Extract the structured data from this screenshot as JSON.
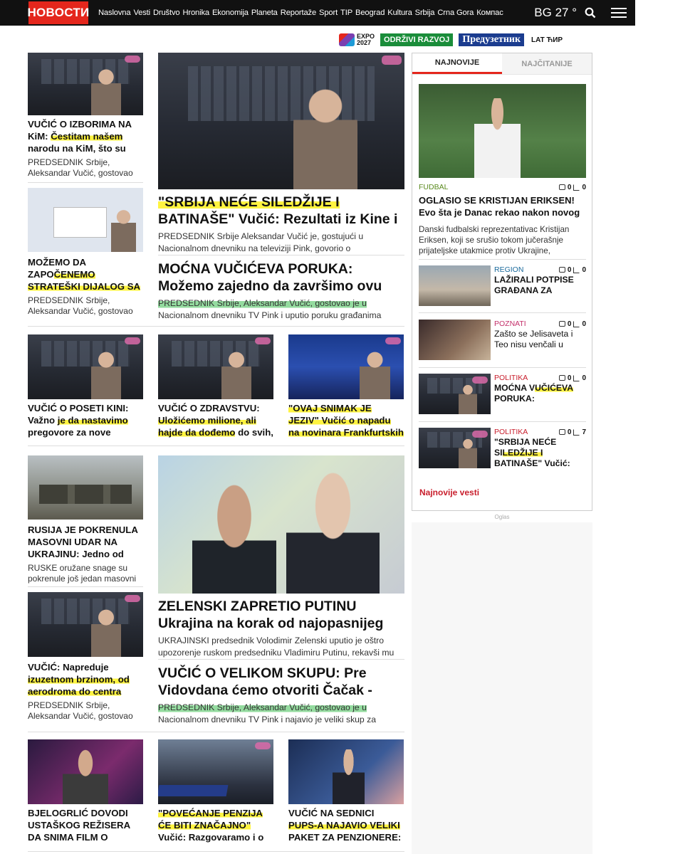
{
  "header": {
    "logo": "НОВОСТИ",
    "nav": [
      "Naslovna",
      "Vesti",
      "Društvo",
      "Hronika",
      "Ekonomija",
      "Planeta",
      "Reportaže",
      "Sport",
      "TIP",
      "Beograd",
      "Kultura",
      "Srbija",
      "Crna Gora",
      "Компас"
    ],
    "weather": "BG 27 °",
    "search_icon": "search-icon",
    "menu_icon": "hamburger-icon"
  },
  "subbar": {
    "expo": "EXPO",
    "expo_year": "2027",
    "odrzivi": "ODRŽIVI RAZVOJ",
    "preduzetnik": "Предузетник",
    "lang": "LAT ЋИР"
  },
  "articles": [
    {
      "headline_a": "VUČIĆ O IZBORIMA NA KiM: ",
      "headline_hl": "Čestitam našem",
      "headline_b": " narodu na KiM, što su",
      "lead": "PREDSEDNIK Srbije, Aleksandar Vučić, gostovao"
    },
    {
      "headline_a": "MOŽEMO DA ZAPO",
      "headline_hl": "ČENEMO STRATEŠKI DIJALOG SA SAD Vučić:",
      "headline_b": "",
      "lead": "PREDSEDNIK Srbije, Aleksandar Vučić, gostovao"
    },
    {
      "headline_a": "",
      "headline_hl": "\"SRBIJA NEĆE SILEDŽIJE I",
      "headline_b": " BATINAŠE\" Vučić: Rezultati iz Kine i",
      "lead": "PREDSEDNIK Srbije Aleksandar Vučić je, gostujući u Nacionalnom dnevniku na televiziji Pink, govorio o"
    },
    {
      "headline": "MOĆNA VUČIĆEVA PORUKA: Možemo zajedno da završimo ovu",
      "lead_a": "PREDSEDNIK Srbije, Aleksandar Vučić, gostovao je u",
      "lead_b": " Nacionalnom dnevniku TV Pink i uputio poruku građanima"
    },
    {
      "headline_a": "VUČIĆ O POSETI KINI: Važno ",
      "headline_hl": "je da nastavimo",
      "headline_b": " pregovore za nove"
    },
    {
      "headline_a": "VUČIĆ O ZDRAVSTVU: ",
      "headline_hl": "Uložićemo milione, ali hajde da dođemo",
      "headline_b": " do svih,"
    },
    {
      "headline_a": "",
      "headline_hl": "\"OVAJ SNIMAK JE JEZIV\" Vučić o napadu na novinara Frankfurtskih",
      "headline_b": ""
    },
    {
      "headline_a": "RUSIJA JE POKRENULA MASOVNI UDAR NA UKRAJINU: Jedno od",
      "headline_hl": "",
      "headline_b": "",
      "lead": "RUSKE oružane snage su pokrenule još jedan masovni"
    },
    {
      "headline": "ZELENSKI ZAPRETIO PUTINU Ukrajina na korak od najopasnijeg",
      "lead": "UKRAJINSKI predsednik Volodimir Zelenski uputio je oštro upozorenje ruskom predsedniku Vladimiru Putinu, rekavši mu"
    },
    {
      "headline_a": "VUČIĆ: Napreduje ",
      "headline_hl": "izuzetnom brzinom, od aerodroma do centra",
      "headline_b": "",
      "lead": "PREDSEDNIK Srbije, Aleksandar Vučić, gostovao"
    },
    {
      "headline": "VUČIĆ O VELIKOM SKUPU: Pre Vidovdana ćemo otvoriti Čačak -",
      "lead_a": "PREDSEDNIK Srbije, Aleksandar Vučić, gostovao je u",
      "lead_b": " Nacionalnom dnevniku TV Pink i najavio je veliki skup za"
    },
    {
      "headline_a": "BJELOGRLIĆ DOVODI USTAŠKOG REŽISERA DA SNIMA FILM O",
      "headline_hl": "",
      "headline_b": ""
    },
    {
      "headline_a": "",
      "headline_hl": "\"POVEĆANJE PENZIJA ĆE BITI ZNAČAJNO\"",
      "headline_b": " Vučić: Razgovaramo i o"
    },
    {
      "headline_a": "VUČIĆ NA SEDNICI ",
      "headline_hl": "PUPS-A NAJAVIO VELIKI",
      "headline_b": " PAKET ZA PENZIONERE:"
    }
  ],
  "sidebar": {
    "tab_latest": "NAJNOVIJE",
    "tab_most_read": "NAJČITANIJE",
    "main": {
      "category": "FUDBAL",
      "comments": "0",
      "shares": "0",
      "headline": "OGLASIO SE KRISTIJAN ERIKSEN! Evo šta je Danac rekao nakon novog",
      "lead": "Danski fudbalski reprezentativac Kristijan Eriksen, koji se srušio tokom jučerašnje prijateljske utakmice protiv Ukrajine,"
    },
    "items": [
      {
        "category": "REGION",
        "comments": "0",
        "shares": "0",
        "headline": "LAŽIRALI POTPISE GRAĐANA ZA"
      },
      {
        "category": "POZNATI",
        "comments": "0",
        "shares": "0",
        "headline": "Zašto se Jelisaveta i Teo nisu venčali u"
      },
      {
        "category": "POLITIKA",
        "comments": "0",
        "shares": "0",
        "headline_a": "MOĆNA V",
        "headline_hl": "UČIĆEVA",
        "headline_b": " PORUKA:"
      },
      {
        "category": "POLITIKA",
        "comments": "0",
        "shares": "7",
        "headline_a": "\"SRBIJA NEĆE SI",
        "headline_hl": "LEDŽIJE I",
        "headline_b": " BATINAŠE\" Vučić:"
      }
    ],
    "latest_link": "Najnovije vesti"
  },
  "ad_label": "Oglas"
}
